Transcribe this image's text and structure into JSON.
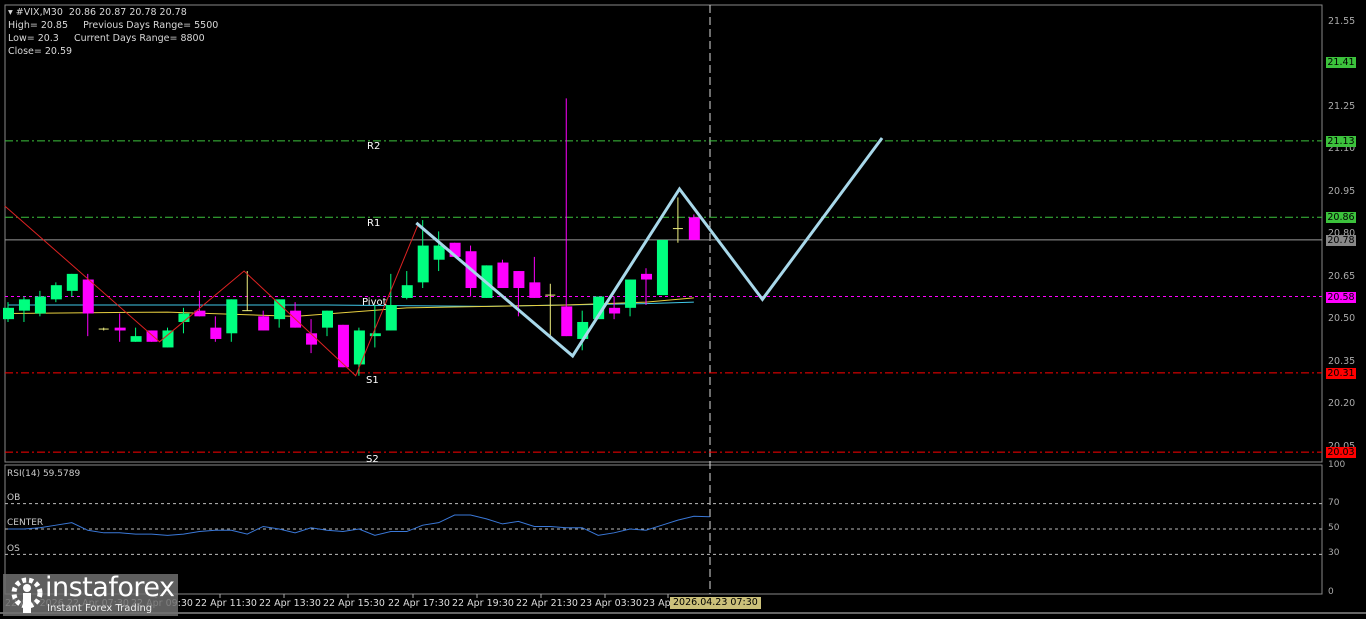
{
  "header": {
    "symbol_line": "#VIX,M30  20.86 20.87 20.78 20.78",
    "high": "High= 20.85",
    "prev_range": "Previous Days Range= 5500",
    "low": "Low= 20.3",
    "curr_range": "Current Days Range= 8800",
    "close": "Close= 20.59"
  },
  "levels": {
    "r2": {
      "name": "R2",
      "price": 21.13,
      "label": "21.13",
      "color": "#3cc23c"
    },
    "r1": {
      "name": "R1",
      "price": 20.86,
      "label": "20.86",
      "color": "#3cc23c"
    },
    "pivot": {
      "name": "Pivot",
      "price": 20.58,
      "label": "20.58",
      "color": "#ff00ff"
    },
    "s1": {
      "name": "S1",
      "price": 20.31,
      "label": "20.31",
      "color": "#ff0000"
    },
    "s2": {
      "name": "S2",
      "price": 20.03,
      "label": "20.03",
      "color": "#ff0000"
    },
    "r3": {
      "price": 21.41,
      "label": "21.41",
      "color": "#3cc23c"
    },
    "current": {
      "price": 20.78,
      "label": "20.78",
      "color": "#888888"
    }
  },
  "price_axis": [
    "21.55",
    "21.25",
    "21.10",
    "20.95",
    "20.80",
    "20.65",
    "20.50",
    "20.35",
    "20.20",
    "20.05"
  ],
  "rsi": {
    "title": "RSI(14) 59.5789",
    "ob": "OB",
    "center": "CENTER",
    "os": "OS",
    "axis": [
      "100",
      "70",
      "50",
      "30",
      "0"
    ],
    "values": [
      50,
      50,
      51,
      53,
      55,
      49,
      47,
      47,
      46,
      46,
      45,
      46,
      48,
      49,
      49,
      46,
      52,
      50,
      47,
      51,
      49,
      48,
      50,
      45,
      48,
      48,
      53,
      55,
      61,
      61,
      58,
      54,
      56,
      52,
      52,
      51,
      51,
      45,
      47,
      50,
      49,
      53,
      57,
      60,
      59.6
    ]
  },
  "time_axis": {
    "labels": [
      "22 Apr 2026",
      "22 Apr 07:30",
      "22 Apr 09:30",
      "22 Apr 11:30",
      "22 Apr 13:30",
      "22 Apr 15:30",
      "22 Apr 17:30",
      "22 Apr 19:30",
      "22 Apr 21:30",
      "23 Apr 03:30",
      "23 Apr"
    ],
    "cursor": "2026.04.23 07:30"
  },
  "chart_data": {
    "type": "candlestick",
    "symbol": "#VIX",
    "timeframe": "M30",
    "ylim": [
      19.98,
      21.6
    ],
    "candles": [
      [
        20.5,
        20.56,
        20.49,
        20.54
      ],
      [
        20.53,
        20.58,
        20.49,
        20.57
      ],
      [
        20.52,
        20.6,
        20.51,
        20.58
      ],
      [
        20.57,
        20.63,
        20.56,
        20.62
      ],
      [
        20.6,
        20.66,
        20.58,
        20.66
      ],
      [
        20.64,
        20.66,
        20.44,
        20.52
      ],
      [
        20.465,
        20.47,
        20.46,
        20.465
      ],
      [
        20.47,
        20.52,
        20.42,
        20.46
      ],
      [
        20.42,
        20.47,
        20.42,
        20.44
      ],
      [
        20.46,
        20.46,
        20.42,
        20.42
      ],
      [
        20.4,
        20.47,
        20.4,
        20.46
      ],
      [
        20.49,
        20.54,
        20.45,
        20.52
      ],
      [
        20.53,
        20.6,
        20.51,
        20.51
      ],
      [
        20.47,
        20.51,
        20.42,
        20.43
      ],
      [
        20.45,
        20.57,
        20.42,
        20.57
      ],
      [
        20.53,
        20.67,
        20.53,
        20.53
      ],
      [
        20.51,
        20.53,
        20.46,
        20.46
      ],
      [
        20.5,
        20.57,
        20.47,
        20.57
      ],
      [
        20.53,
        20.56,
        20.47,
        20.47
      ],
      [
        20.45,
        20.5,
        20.38,
        20.41
      ],
      [
        20.47,
        20.53,
        20.44,
        20.53
      ],
      [
        20.48,
        20.48,
        20.33,
        20.33
      ],
      [
        20.34,
        20.47,
        20.3,
        20.46
      ],
      [
        20.44,
        20.55,
        20.4,
        20.45
      ],
      [
        20.46,
        20.66,
        20.46,
        20.55
      ],
      [
        20.575,
        20.67,
        20.57,
        20.62
      ],
      [
        20.63,
        20.85,
        20.61,
        20.76
      ],
      [
        20.71,
        20.81,
        20.67,
        20.76
      ],
      [
        20.77,
        20.77,
        20.72,
        20.72
      ],
      [
        20.74,
        20.76,
        20.58,
        20.61
      ],
      [
        20.575,
        20.69,
        20.575,
        20.69
      ],
      [
        20.7,
        20.71,
        20.61,
        20.61
      ],
      [
        20.67,
        20.67,
        20.51,
        20.61
      ],
      [
        20.63,
        20.72,
        20.575,
        20.575
      ],
      [
        20.585,
        20.625,
        20.44,
        20.585
      ],
      [
        20.545,
        21.28,
        20.44,
        20.44
      ],
      [
        20.43,
        20.53,
        20.39,
        20.49
      ],
      [
        20.5,
        20.58,
        20.5,
        20.58
      ],
      [
        20.54,
        20.58,
        20.5,
        20.52
      ],
      [
        20.54,
        20.64,
        20.51,
        20.64
      ],
      [
        20.66,
        20.68,
        20.55,
        20.64
      ],
      [
        20.585,
        20.78,
        20.585,
        20.78
      ],
      [
        20.82,
        20.93,
        20.77,
        20.82
      ],
      [
        20.86,
        20.87,
        20.78,
        20.78
      ]
    ],
    "candle_format": [
      "open",
      "high",
      "low",
      "close"
    ],
    "ma_fast": [
      [
        0,
        20.55
      ],
      [
        10,
        20.55
      ],
      [
        20,
        20.55
      ],
      [
        30,
        20.545
      ],
      [
        40,
        20.555
      ],
      [
        43,
        20.56
      ]
    ],
    "ma_slow": [
      [
        0,
        20.52
      ],
      [
        10,
        20.525
      ],
      [
        18,
        20.51
      ],
      [
        25,
        20.54
      ],
      [
        35,
        20.55
      ],
      [
        40,
        20.56
      ],
      [
        43,
        20.575
      ]
    ],
    "zigzag": [
      [
        -0.2,
        20.9
      ],
      [
        9.5,
        20.42
      ],
      [
        14.8,
        20.67
      ],
      [
        21.8,
        20.3
      ],
      [
        25.75,
        20.84
      ]
    ],
    "forecast": [
      [
        25.6,
        20.84
      ],
      [
        35.4,
        20.37
      ],
      [
        42.1,
        20.96
      ],
      [
        47.3,
        20.57
      ],
      [
        54.8,
        21.14
      ]
    ],
    "colors": {
      "bull": "#00ff7f",
      "bear": "#ff00ff",
      "ma_fast": "#40c8e8",
      "ma_slow": "#e8d040",
      "zigzag": "#dd2222",
      "forecast": "#a8d8ea",
      "rsi": "#3a78d8"
    }
  },
  "logo": {
    "brand": "instaforex",
    "tagline": "Instant Forex Trading"
  }
}
